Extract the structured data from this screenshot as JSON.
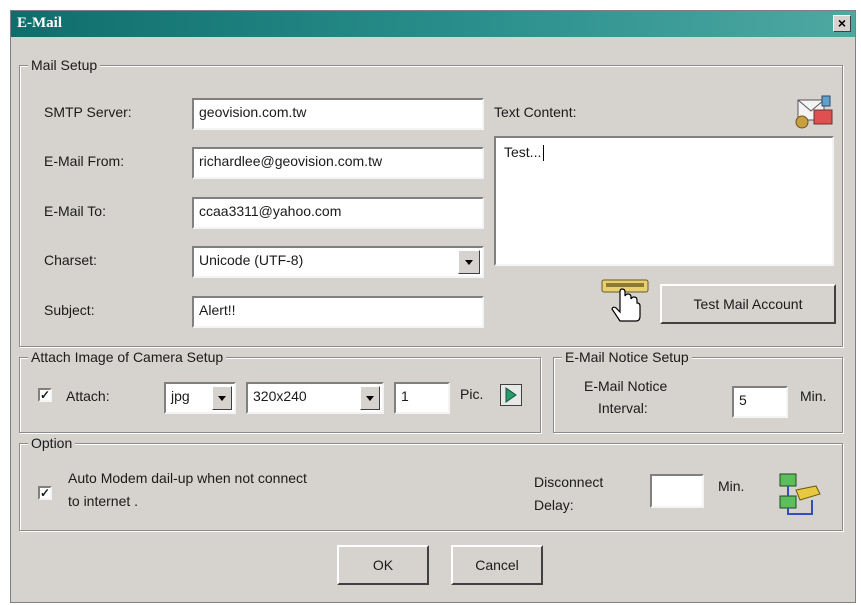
{
  "window": {
    "title": "E-Mail",
    "close_glyph": "×"
  },
  "mail_setup": {
    "legend": "Mail Setup",
    "smtp_label": "SMTP Server:",
    "smtp_value": "geovision.com.tw",
    "from_label": "E-Mail From:",
    "from_value": "richardlee@geovision.com.tw",
    "to_label": "E-Mail To:",
    "to_value": "ccaa3311@yahoo.com",
    "charset_label": "Charset:",
    "charset_value": "Unicode (UTF-8)",
    "subject_label": "Subject:",
    "subject_value": "Alert!!",
    "text_content_label": "Text Content:",
    "text_content_value": "Test...",
    "test_button": "Test Mail Account"
  },
  "attach_setup": {
    "legend": "Attach Image of Camera Setup",
    "attach_label": "Attach:",
    "attach_checked": true,
    "format_value": "jpg",
    "size_value": "320x240",
    "pic_value": "1",
    "pic_label": "Pic."
  },
  "notice_setup": {
    "legend": "E-Mail Notice Setup",
    "interval_label_1": "E-Mail Notice",
    "interval_label_2": "Interval:",
    "interval_value": "5",
    "unit": "Min."
  },
  "option": {
    "legend": "Option",
    "modem_checked": true,
    "modem_label_1": "Auto Modem dail-up when not connect",
    "modem_label_2": "to internet .",
    "disconnect_label_1": "Disconnect",
    "disconnect_label_2": "Delay:",
    "disconnect_value": "",
    "unit": "Min."
  },
  "footer": {
    "ok": "OK",
    "cancel": "Cancel"
  },
  "icons": [
    "mail-settings-icon",
    "hand-pointer-icon",
    "play-arrow-icon",
    "network-modem-icon"
  ],
  "colors": {
    "titlebar": "#0f6e6c",
    "dialog": "#d6d3ce"
  }
}
